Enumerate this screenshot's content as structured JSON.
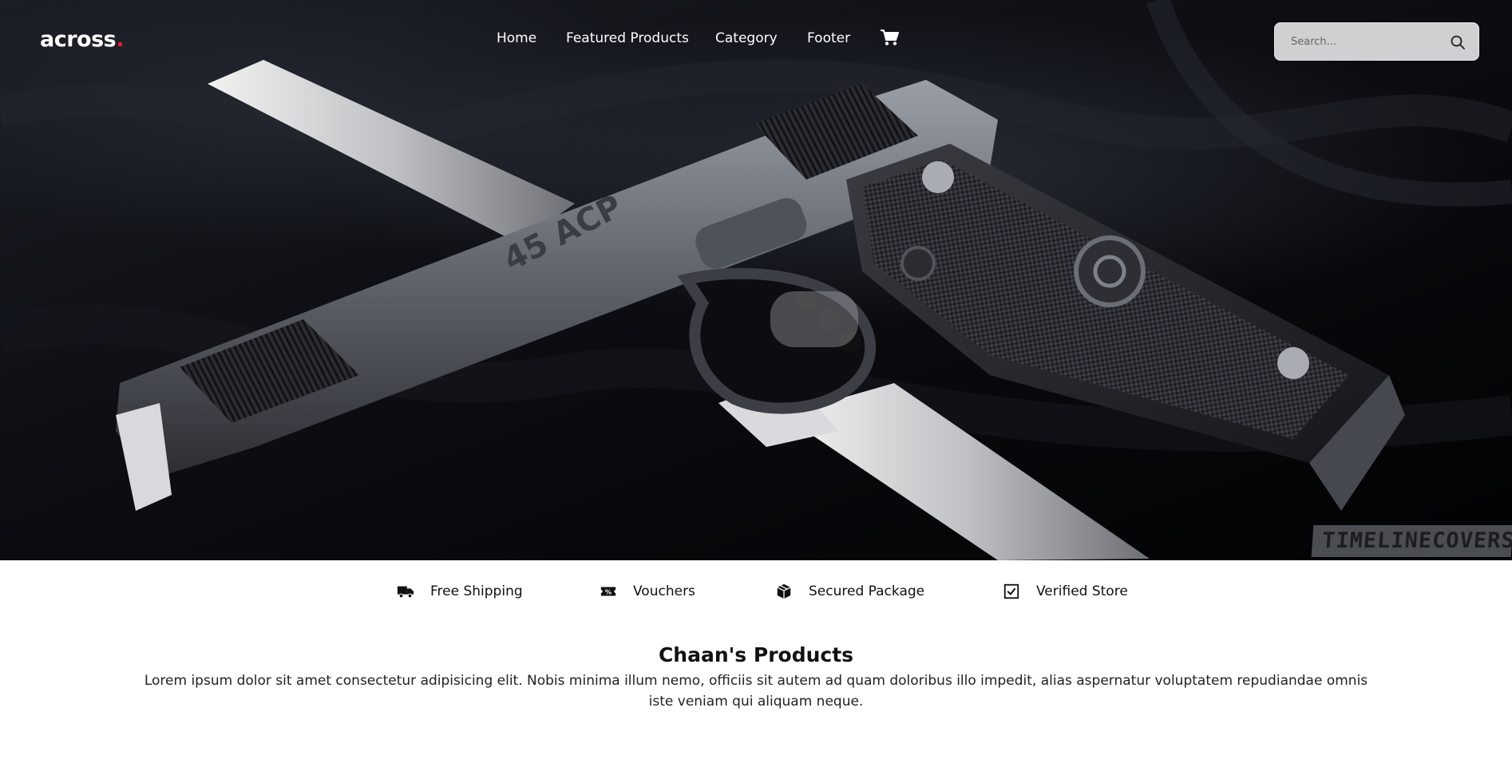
{
  "header": {
    "logo_text": "across",
    "logo_dot": ".",
    "nav": [
      {
        "label": "Home"
      },
      {
        "label": "Featured Products"
      },
      {
        "label": "Category"
      },
      {
        "label": "Footer"
      }
    ],
    "cart_icon": "cart-icon",
    "search": {
      "placeholder": "Search...",
      "icon": "search-icon"
    }
  },
  "hero": {
    "image": "pistol-and-knife-on-black-cloth",
    "slide_engraving": "45 ACP",
    "watermark": "TIMELINECOVERS.PRO"
  },
  "features": [
    {
      "label": "Free Shipping",
      "icon": "truck-icon"
    },
    {
      "label": "Vouchers",
      "icon": "ticket-icon"
    },
    {
      "label": "Secured Package",
      "icon": "package-icon"
    },
    {
      "label": "Verified Store",
      "icon": "check-square-icon"
    }
  ],
  "products": {
    "title": "Chaan's Products",
    "description": "Lorem ipsum dolor sit amet consectetur adipisicing elit. Nobis minima illum nemo, officiis sit autem ad quam doloribus illo impedit, alias aspernatur voluptatem repudiandae omnis iste veniam qui aliquam neque."
  },
  "colors": {
    "accent": "#e11d2a",
    "hero_bg": "#0a0b0f",
    "search_bg": "#cfd0d2",
    "text": "#111111"
  }
}
